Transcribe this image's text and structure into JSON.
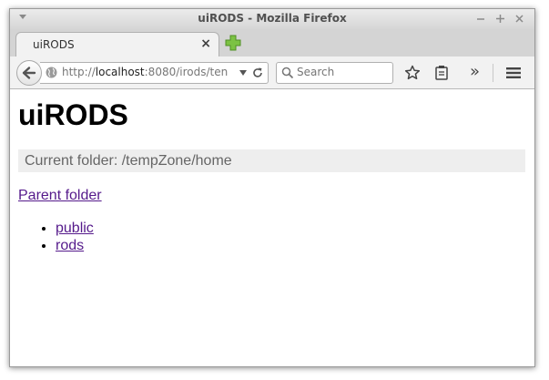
{
  "window": {
    "title": "uiRODS - Mozilla Firefox"
  },
  "tab": {
    "label": "uiRODS",
    "close_glyph": "×"
  },
  "navbar": {
    "url_prefix": "http://",
    "url_host": "localhost",
    "url_rest": ":8080/irods/ten",
    "search_placeholder": "Search",
    "overflow_glyph": "»"
  },
  "page": {
    "heading": "uiRODS",
    "current_folder": "Current folder: /tempZone/home",
    "parent_link": "Parent folder",
    "folders": [
      "public",
      "rods"
    ]
  },
  "colors": {
    "link_visited": "#551a8b",
    "folder_bar_bg": "#eeeeee",
    "new_tab_green": "#7cc243"
  }
}
